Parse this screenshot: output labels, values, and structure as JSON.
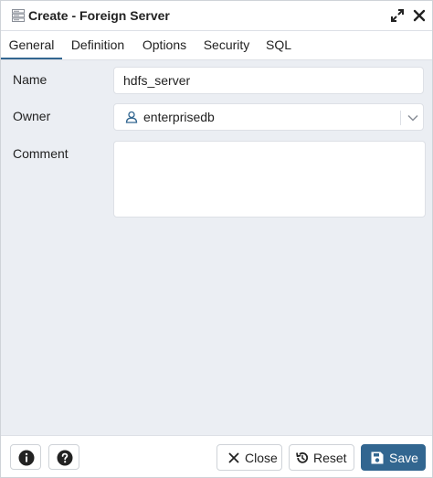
{
  "dialog": {
    "title": "Create - Foreign Server"
  },
  "tabs": [
    {
      "label": "General",
      "active": true
    },
    {
      "label": "Definition",
      "active": false
    },
    {
      "label": "Options",
      "active": false
    },
    {
      "label": "Security",
      "active": false
    },
    {
      "label": "SQL",
      "active": false
    }
  ],
  "form": {
    "name_label": "Name",
    "name_value": "hdfs_server",
    "owner_label": "Owner",
    "owner_value": "enterprisedb",
    "comment_label": "Comment",
    "comment_value": ""
  },
  "footer": {
    "close_label": "Close",
    "reset_label": "Reset",
    "save_label": "Save"
  },
  "colors": {
    "accent": "#326690",
    "body_bg": "#ebeef3",
    "border": "#dde0e6",
    "text": "#222222"
  },
  "icons": {
    "title": "foreign-server-icon",
    "maximize": "expand-icon",
    "close": "close-icon",
    "owner": "user-icon",
    "chevron": "chevron-down-icon",
    "info": "info-icon",
    "help": "help-icon",
    "close_button": "x-icon",
    "reset": "reset-icon",
    "save": "save-icon"
  }
}
